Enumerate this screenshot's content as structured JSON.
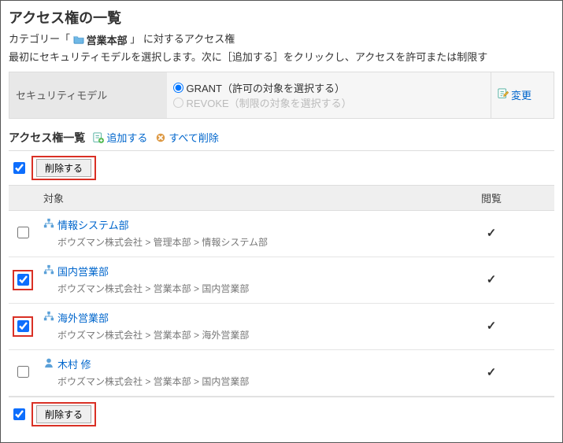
{
  "page_title": "アクセス権の一覧",
  "crumb_prefix": "カテゴリー「",
  "crumb_category": "営業本部",
  "crumb_suffix": "」 に対するアクセス権",
  "description": "最初にセキュリティモデルを選択します。次に［追加する］をクリックし、アクセスを許可または制限す",
  "sec_model": {
    "label": "セキュリティモデル",
    "grant_label": "GRANT（許可の対象を選択する）",
    "revoke_label": "REVOKE（制限の対象を選択する）",
    "change_link": "変更"
  },
  "list_header": "アクセス権一覧",
  "add_link": "追加する",
  "delete_all_link": "すべて削除",
  "delete_button": "削除する",
  "columns": {
    "target": "対象",
    "view": "閲覧"
  },
  "rows": [
    {
      "checked": false,
      "kind": "org",
      "name": "情報システム部",
      "path": "ボウズマン株式会社 > 管理本部 > 情報システム部",
      "view": true,
      "red": false
    },
    {
      "checked": true,
      "kind": "org",
      "name": "国内営業部",
      "path": "ボウズマン株式会社 > 営業本部 > 国内営業部",
      "view": true,
      "red": true
    },
    {
      "checked": true,
      "kind": "org",
      "name": "海外営業部",
      "path": "ボウズマン株式会社 > 営業本部 > 海外営業部",
      "view": true,
      "red": true
    },
    {
      "checked": false,
      "kind": "user",
      "name": "木村 修",
      "path": "ボウズマン株式会社 > 営業本部 > 国内営業部",
      "view": true,
      "red": false
    }
  ]
}
